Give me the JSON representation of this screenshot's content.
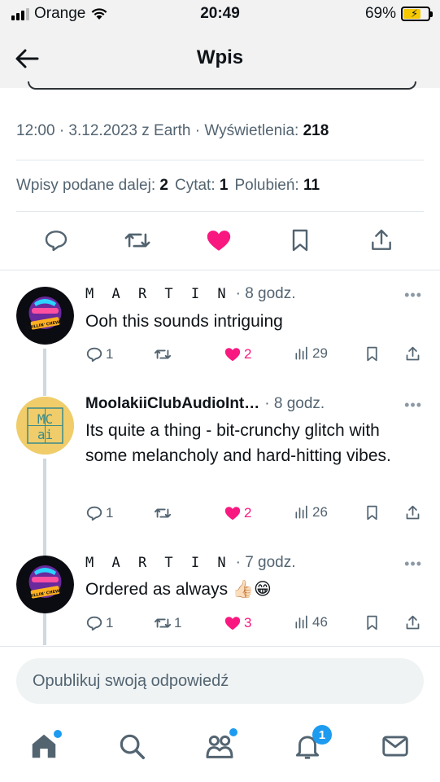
{
  "status_bar": {
    "carrier": "Orange",
    "time": "20:49",
    "battery": "69%",
    "battery_level": 0.69
  },
  "header": {
    "title": "Wpis"
  },
  "post_meta": {
    "time_date": "12:00 · 3.12.2023 z Earth · ",
    "views_label": "Wyświetlenia: ",
    "views": "218"
  },
  "post_stats": {
    "retweets_label": "Wpisy podane dalej: ",
    "retweets": "2",
    "quotes_label": "Cytat: ",
    "quotes": "1",
    "likes_label": "Polubień: ",
    "likes": "11"
  },
  "post_actions": [
    "reply-icon",
    "retweet-icon",
    "heart-filled-icon",
    "bookmark-icon",
    "share-icon"
  ],
  "replies": [
    {
      "author": "M A R T I N",
      "time": "· 8 godz.",
      "text": "Ooh this sounds intriguing",
      "replies": "1",
      "retweets": "",
      "likes": "2",
      "views": "29",
      "liked": true
    },
    {
      "author": "MoolakiiClubAudioInt…",
      "time": "· 8 godz.",
      "text": "Its quite a thing - bit-crunchy glitch with some melancholy and hard-hitting vibes.",
      "replies": "1",
      "retweets": "",
      "likes": "2",
      "views": "26",
      "liked": true
    },
    {
      "author": "M A R T I N",
      "time": "· 7 godz.",
      "text": "Ordered as always 👍🏻😁",
      "replies": "1",
      "retweets": "1",
      "likes": "3",
      "views": "46",
      "liked": true
    }
  ],
  "avatar_text": {
    "martin": "CHILLIN' CHEWIE",
    "moolakii": [
      "MC",
      "ai"
    ]
  },
  "reply_bar": {
    "placeholder": "Opublikuj swoją odpowiedź"
  },
  "bottom_nav": {
    "items": [
      "home-icon",
      "search-icon",
      "communities-icon",
      "notifications-icon",
      "messages-icon"
    ],
    "notifications_badge": "1"
  },
  "colors": {
    "like": "#f91880",
    "accent": "#1d9bf0",
    "secondary_text": "#536471"
  }
}
